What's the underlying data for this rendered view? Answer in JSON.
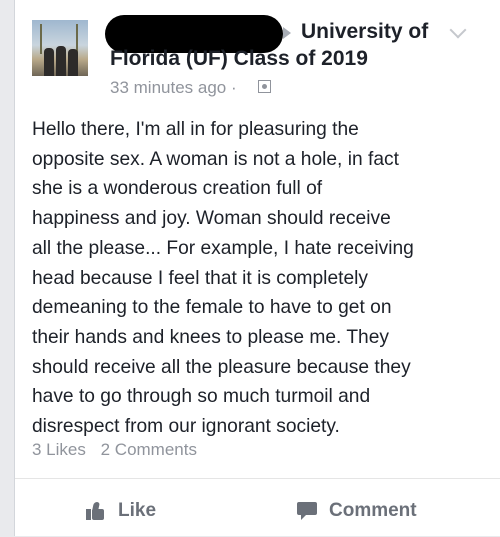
{
  "post": {
    "group_line_1": "University of",
    "group_line_2": "Florida (UF) Class of 2019",
    "timestamp": "33 minutes ago ·",
    "icons": {
      "avatar": "profile-photo",
      "arrow": "right-arrow-icon",
      "privacy": "group-privacy-icon",
      "menu": "chevron-down-icon"
    },
    "body": "Hello there, I'm all in for pleasuring the\nopposite sex. A woman is not a hole, in fact\nshe is a wonderous creation full of\nhappiness and joy. Woman should receive\nall the please... For example, I hate receiving\nhead because I feel that it is completely\ndemeaning to the female to have to get on\ntheir hands and knees to please me. They\nshould receive all the pleasure because they\nhave to go through so much turmoil and\ndisrespect from our ignorant society."
  },
  "stats": {
    "likes": "3 Likes",
    "comments": "2 Comments"
  },
  "actions": {
    "like_label": "Like",
    "comment_label": "Comment"
  },
  "colors": {
    "text": "#1d2129",
    "muted": "#90949c",
    "action": "#6b7079",
    "background": "#e9eaed"
  }
}
